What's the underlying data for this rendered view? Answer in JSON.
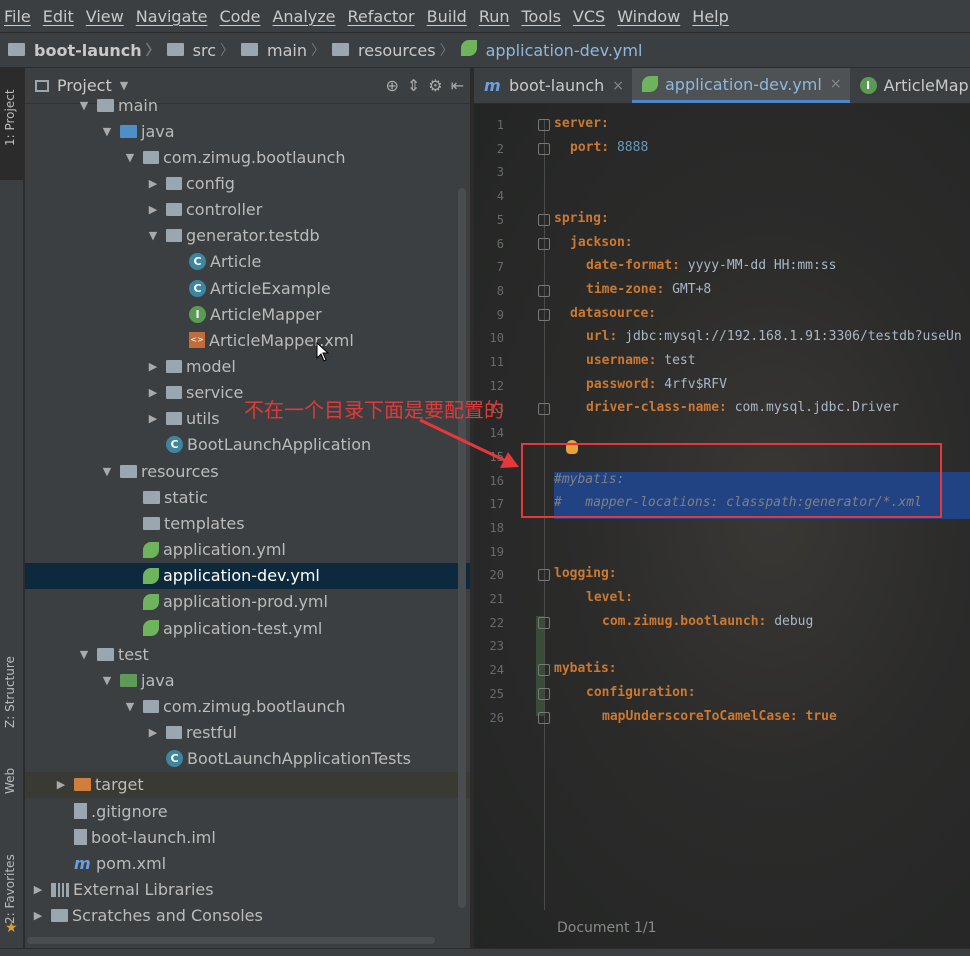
{
  "menu": [
    "File",
    "Edit",
    "View",
    "Navigate",
    "Code",
    "Analyze",
    "Refactor",
    "Build",
    "Run",
    "Tools",
    "VCS",
    "Window",
    "Help"
  ],
  "breadcrumb": [
    "boot-launch",
    "src",
    "main",
    "resources",
    "application-dev.yml"
  ],
  "side_tabs": {
    "project": "1: Project",
    "structure": "Z: Structure",
    "web": "Web",
    "favorites": "2: Favorites"
  },
  "project_panel": {
    "title": "Project",
    "tree": [
      {
        "label": "main",
        "depth": 2,
        "icon": "folder",
        "expand": "open"
      },
      {
        "label": "java",
        "depth": 3,
        "icon": "folder-src",
        "expand": "open"
      },
      {
        "label": "com.zimug.bootlaunch",
        "depth": 4,
        "icon": "package",
        "expand": "open"
      },
      {
        "label": "config",
        "depth": 5,
        "icon": "package",
        "expand": "closed"
      },
      {
        "label": "controller",
        "depth": 5,
        "icon": "package",
        "expand": "closed"
      },
      {
        "label": "generator.testdb",
        "depth": 5,
        "icon": "package",
        "expand": "open"
      },
      {
        "label": "Article",
        "depth": 6,
        "icon": "class",
        "expand": "none"
      },
      {
        "label": "ArticleExample",
        "depth": 6,
        "icon": "class",
        "expand": "none"
      },
      {
        "label": "ArticleMapper",
        "depth": 6,
        "icon": "interface",
        "expand": "none"
      },
      {
        "label": "ArticleMapper.xml",
        "depth": 6,
        "icon": "xml",
        "expand": "none"
      },
      {
        "label": "model",
        "depth": 5,
        "icon": "package",
        "expand": "closed"
      },
      {
        "label": "service",
        "depth": 5,
        "icon": "package",
        "expand": "closed"
      },
      {
        "label": "utils",
        "depth": 5,
        "icon": "package",
        "expand": "closed"
      },
      {
        "label": "BootLaunchApplication",
        "depth": 5,
        "icon": "spring-class",
        "expand": "none"
      },
      {
        "label": "resources",
        "depth": 3,
        "icon": "folder-res",
        "expand": "open"
      },
      {
        "label": "static",
        "depth": 4,
        "icon": "folder",
        "expand": "none"
      },
      {
        "label": "templates",
        "depth": 4,
        "icon": "folder",
        "expand": "none"
      },
      {
        "label": "application.yml",
        "depth": 4,
        "icon": "spring-yml",
        "expand": "none"
      },
      {
        "label": "application-dev.yml",
        "depth": 4,
        "icon": "spring-yml",
        "expand": "none",
        "selected": true
      },
      {
        "label": "application-prod.yml",
        "depth": 4,
        "icon": "spring-yml",
        "expand": "none"
      },
      {
        "label": "application-test.yml",
        "depth": 4,
        "icon": "spring-yml",
        "expand": "none"
      },
      {
        "label": "test",
        "depth": 2,
        "icon": "folder",
        "expand": "open"
      },
      {
        "label": "java",
        "depth": 3,
        "icon": "folder-test",
        "expand": "open"
      },
      {
        "label": "com.zimug.bootlaunch",
        "depth": 4,
        "icon": "package",
        "expand": "open"
      },
      {
        "label": "restful",
        "depth": 5,
        "icon": "package",
        "expand": "closed"
      },
      {
        "label": "BootLaunchApplicationTests",
        "depth": 5,
        "icon": "spring-class",
        "expand": "none"
      },
      {
        "label": "target",
        "depth": 1,
        "icon": "folder-target",
        "expand": "closed",
        "excluded": true
      },
      {
        "label": ".gitignore",
        "depth": 1,
        "icon": "file",
        "expand": "none"
      },
      {
        "label": "boot-launch.iml",
        "depth": 1,
        "icon": "file",
        "expand": "none"
      },
      {
        "label": "pom.xml",
        "depth": 1,
        "icon": "maven",
        "expand": "none"
      },
      {
        "label": "External Libraries",
        "depth": 0,
        "icon": "library",
        "expand": "closed"
      },
      {
        "label": "Scratches and Consoles",
        "depth": 0,
        "icon": "scratch",
        "expand": "closed"
      }
    ]
  },
  "editor": {
    "tabs": [
      {
        "label": "boot-launch",
        "icon": "maven",
        "active": false
      },
      {
        "label": "application-dev.yml",
        "icon": "spring-yml",
        "active": true
      },
      {
        "label": "ArticleMapper",
        "icon": "interface",
        "active": false
      }
    ],
    "lines": [
      {
        "n": "1",
        "indent": 0,
        "key": "server:",
        "val": "",
        "style": "kv"
      },
      {
        "n": "2",
        "indent": 1,
        "key": "port:",
        "val": " 8888",
        "style": "kv-num"
      },
      {
        "n": "3",
        "indent": 0,
        "key": "",
        "val": "",
        "style": "empty"
      },
      {
        "n": "4",
        "indent": 0,
        "key": "",
        "val": "",
        "style": "empty"
      },
      {
        "n": "5",
        "indent": 0,
        "key": "spring:",
        "val": "",
        "style": "kv"
      },
      {
        "n": "6",
        "indent": 1,
        "key": "jackson:",
        "val": "",
        "style": "kv"
      },
      {
        "n": "7",
        "indent": 2,
        "key": "date-format:",
        "val": " yyyy-MM-dd HH:mm:ss",
        "style": "kv"
      },
      {
        "n": "8",
        "indent": 2,
        "key": "time-zone:",
        "val": " GMT+8",
        "style": "kv"
      },
      {
        "n": "9",
        "indent": 1,
        "key": "datasource:",
        "val": "",
        "style": "kv"
      },
      {
        "n": "10",
        "indent": 2,
        "key": "url:",
        "val": " jdbc:mysql://192.168.1.91:3306/testdb?useUn",
        "style": "kv"
      },
      {
        "n": "11",
        "indent": 2,
        "key": "username:",
        "val": " test",
        "style": "kv"
      },
      {
        "n": "12",
        "indent": 2,
        "key": "password:",
        "val": " 4rfv$RFV",
        "style": "kv"
      },
      {
        "n": "13",
        "indent": 2,
        "key": "driver-class-name:",
        "val": " com.mysql.jdbc.Driver",
        "style": "kv"
      },
      {
        "n": "14",
        "indent": 0,
        "key": "",
        "val": "",
        "style": "empty"
      },
      {
        "n": "15",
        "indent": 0,
        "key": "",
        "val": "",
        "style": "empty"
      },
      {
        "n": "16",
        "indent": 0,
        "key": "",
        "val": "#mybatis:",
        "style": "comment-sel"
      },
      {
        "n": "17",
        "indent": 0,
        "key": "",
        "val": "#   mapper-locations: classpath:generator/*.xml",
        "style": "comment-sel"
      },
      {
        "n": "18",
        "indent": 0,
        "key": "",
        "val": "",
        "style": "empty"
      },
      {
        "n": "19",
        "indent": 0,
        "key": "",
        "val": "",
        "style": "empty"
      },
      {
        "n": "20",
        "indent": 0,
        "key": "logging:",
        "val": "",
        "style": "kv"
      },
      {
        "n": "21",
        "indent": 2,
        "key": "level:",
        "val": "",
        "style": "kv"
      },
      {
        "n": "22",
        "indent": 3,
        "key": "com.zimug.bootlaunch:",
        "val": " debug",
        "style": "kv"
      },
      {
        "n": "23",
        "indent": 0,
        "key": "",
        "val": "",
        "style": "empty"
      },
      {
        "n": "24",
        "indent": 0,
        "key": "mybatis:",
        "val": "",
        "style": "kv"
      },
      {
        "n": "25",
        "indent": 2,
        "key": "configuration:",
        "val": "",
        "style": "kv"
      },
      {
        "n": "26",
        "indent": 3,
        "key": "mapUnderscoreToCamelCase:",
        "val": " true",
        "style": "kv-bool"
      }
    ],
    "doc_position": "Document 1/1"
  },
  "annotation": {
    "text": "不在一个目录下面是要配置的",
    "color": "#e03a3a"
  },
  "colors": {
    "accent": "#4a88c7",
    "selection": "#214283",
    "yaml_key": "#cc7832",
    "number": "#6897bb",
    "comment": "#808080"
  }
}
